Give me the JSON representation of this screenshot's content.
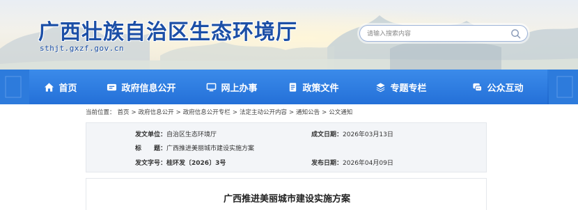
{
  "header": {
    "site_title": "广西壮族自治区生态环境厅",
    "site_domain": "sthjt.gxzf.gov.cn",
    "search_placeholder": "请输入搜索内容",
    "search_icon": "search-icon"
  },
  "nav": {
    "items": [
      {
        "label": "首页",
        "icon": "home-icon"
      },
      {
        "label": "政府信息公开",
        "icon": "info-disclosure-icon"
      },
      {
        "label": "网上办事",
        "icon": "monitor-icon"
      },
      {
        "label": "政策文件",
        "icon": "document-icon"
      },
      {
        "label": "专题专栏",
        "icon": "layers-icon"
      },
      {
        "label": "公众互动",
        "icon": "chat-icon"
      }
    ]
  },
  "breadcrumb": {
    "prefix": "当前位置：",
    "items": [
      "首页",
      "政府信息公开",
      "政府信息公开专栏",
      "法定主动公开内容",
      "通知公告",
      "公文通知"
    ],
    "separator": ">"
  },
  "meta": {
    "issuer_label": "发文单位：",
    "issuer_value": "自治区生态环境厅",
    "created_label": "成文日期：",
    "created_value": "2026年03月13日",
    "title_label": "标　　题：",
    "title_value": "广西推进美丽城市建设实施方案",
    "docno_label": "发文字号：",
    "docno_value": "桂环发〔2026〕3号",
    "published_label": "发布日期：",
    "published_value": "2026年04月09日"
  },
  "article": {
    "title": "广西推进美丽城市建设实施方案"
  }
}
